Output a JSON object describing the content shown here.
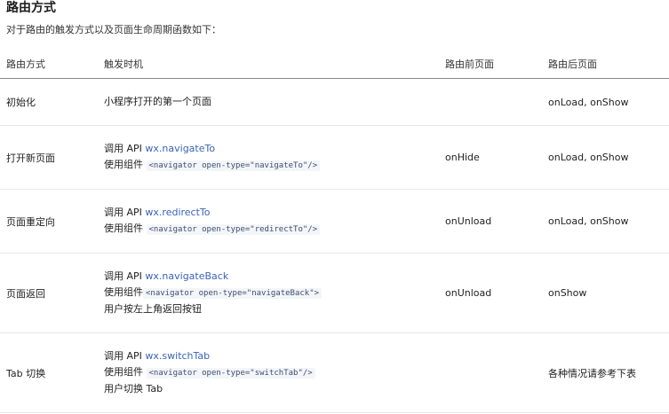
{
  "heading": "路由方式",
  "intro": "对于路由的触发方式以及页面生命周期函数如下：",
  "columns": [
    "路由方式",
    "触发时机",
    "路由前页面",
    "路由后页面"
  ],
  "rows": [
    {
      "method": "初始化",
      "trigger_lines": [
        {
          "text": "小程序打开的第一个页面"
        }
      ],
      "before": "",
      "after": "onLoad, onShow"
    },
    {
      "method": "打开新页面",
      "trigger_lines": [
        {
          "prefix": "调用 API ",
          "api": "wx.navigateTo"
        },
        {
          "prefix": "使用组件 ",
          "code": "<navigator open-type=\"navigateTo\"/>"
        }
      ],
      "before": "onHide",
      "after": "onLoad, onShow"
    },
    {
      "method": "页面重定向",
      "trigger_lines": [
        {
          "prefix": "调用 API ",
          "api": "wx.redirectTo"
        },
        {
          "prefix": "使用组件 ",
          "code": "<navigator open-type=\"redirectTo\"/>"
        }
      ],
      "before": "onUnload",
      "after": "onLoad, onShow"
    },
    {
      "method": "页面返回",
      "trigger_lines": [
        {
          "prefix": "调用 API ",
          "api": "wx.navigateBack"
        },
        {
          "prefix": "使用组件",
          "code": "<navigator open-type=\"navigateBack\">"
        },
        {
          "text": "用户按左上角返回按钮"
        }
      ],
      "before": "onUnload",
      "after": "onShow"
    },
    {
      "method": "Tab 切换",
      "trigger_lines": [
        {
          "prefix": "调用 API ",
          "api": "wx.switchTab"
        },
        {
          "prefix": "使用组件 ",
          "code": "<navigator open-type=\"switchTab\"/>"
        },
        {
          "text": "用户切换 Tab"
        }
      ],
      "before": "",
      "after": "各种情况请参考下表"
    }
  ],
  "colors": {
    "api_link": "#3a63b6",
    "code_bg": "#f3f5f8"
  }
}
